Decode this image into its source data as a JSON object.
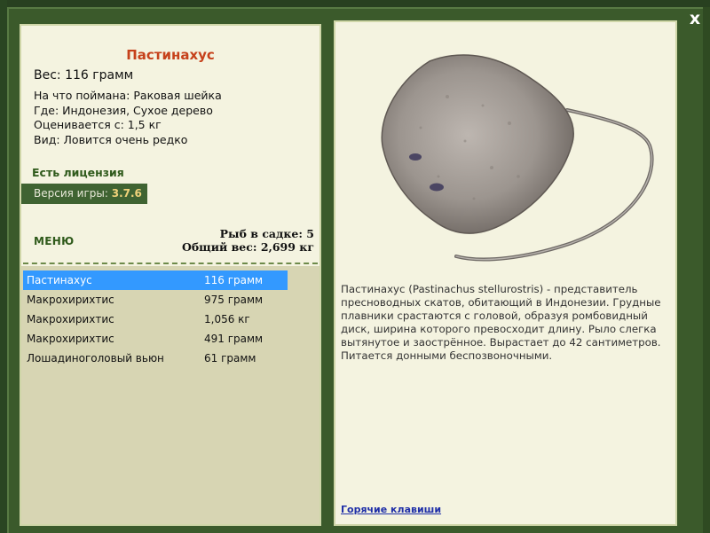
{
  "window": {
    "close_label": "x"
  },
  "fish": {
    "name": "Пастинахус",
    "weight_line": "Вес: 116 грамм",
    "caught_on": "На что поймана: Раковая шейка",
    "location": "Где: Индонезия, Сухое дерево",
    "valued_from": "Оценивается с: 1,5 кг",
    "rarity": "Вид: Ловится очень редко",
    "description": "Пастинахус (Pastinachus stellurostris) - представитель пресноводных скатов, обитающий в Индонезии. Грудные плавники срастаются с головой, образуя ромбовидный диск, ширина которого превосходит длину. Рыло слегка вытянутое и заострённое. Вырастает до 42 сантиметров. Питается донными беспозвоночными."
  },
  "license": "Есть лицензия",
  "version": {
    "label": "Версия игры: ",
    "value": "3.7.6"
  },
  "menu_label": "МЕНЮ",
  "stats": {
    "fish_in_keepnet": "Рыб в садке: 5",
    "total_weight": "Общий вес: 2,699 кг"
  },
  "catch_list": [
    {
      "name": "Пастинахус",
      "weight": "116 грамм",
      "selected": true
    },
    {
      "name": "Макрохирихтис",
      "weight": "975 грамм",
      "selected": false
    },
    {
      "name": "Макрохирихтис",
      "weight": "1,056 кг",
      "selected": false
    },
    {
      "name": "Макрохирихтис",
      "weight": "491 грамм",
      "selected": false
    },
    {
      "name": "Лошадиноголовый вьюн",
      "weight": "61 грамм",
      "selected": false
    }
  ],
  "hotkeys_label": "Горячие клавиши",
  "colors": {
    "selection": "#3399ff",
    "title": "#c6411b",
    "accent_green": "#2f5a1b",
    "panel_bg": "#f4f3e0"
  }
}
